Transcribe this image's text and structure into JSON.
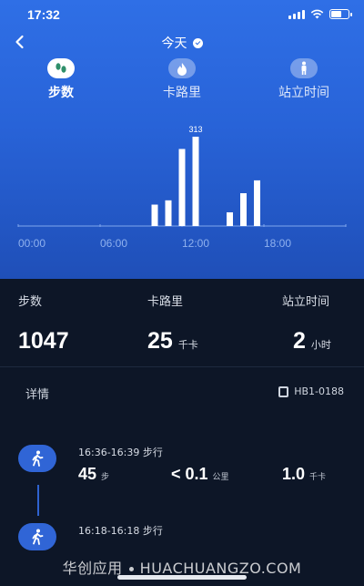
{
  "status_bar": {
    "time": "17:32"
  },
  "nav": {
    "title": "今天"
  },
  "metric_tabs": [
    {
      "label": "步数",
      "icon": "footprints-icon",
      "active": true
    },
    {
      "label": "卡路里",
      "icon": "flame-icon",
      "active": false
    },
    {
      "label": "站立时间",
      "icon": "standing-person-icon",
      "active": false
    }
  ],
  "chart_data": {
    "type": "bar",
    "x_ticks": [
      "00:00",
      "06:00",
      "12:00",
      "18:00"
    ],
    "xlim": [
      0,
      24
    ],
    "ylim": [
      0,
      313
    ],
    "bars": [
      {
        "hour": 10.0,
        "value": 75
      },
      {
        "hour": 11.0,
        "value": 90
      },
      {
        "hour": 12.0,
        "value": 270
      },
      {
        "hour": 13.0,
        "value": 313
      },
      {
        "hour": 15.5,
        "value": 48
      },
      {
        "hour": 16.5,
        "value": 115
      },
      {
        "hour": 17.5,
        "value": 160
      }
    ],
    "max_label": "313",
    "grid": false,
    "colors": {
      "bar": "#ffffff",
      "axis": "#7fa6ec",
      "tick": "#8fb1ee"
    }
  },
  "summary": {
    "steps": {
      "label": "步数",
      "value": "1047",
      "unit": ""
    },
    "calories": {
      "label": "卡路里",
      "value": "25",
      "unit": "千卡"
    },
    "standing": {
      "label": "站立时间",
      "value": "2",
      "unit": "小时"
    }
  },
  "details": {
    "title": "详情",
    "device": "HB1-0188",
    "activities": [
      {
        "time": "16:36-16:39 步行",
        "steps": "45",
        "steps_unit": "步",
        "distance": "< 0.1",
        "distance_unit": "公里",
        "calories": "1.0",
        "calories_unit": "千卡"
      },
      {
        "time": "16:18-16:18 步行"
      }
    ]
  },
  "watermark": {
    "left": "华创应用",
    "right": "HUACHUANGZO.COM"
  },
  "colors": {
    "top_gradient_start": "#2f6fe6",
    "top_gradient_end": "#1f4fb8",
    "bottom_bg": "#0d1627",
    "accent": "#3065d6"
  }
}
